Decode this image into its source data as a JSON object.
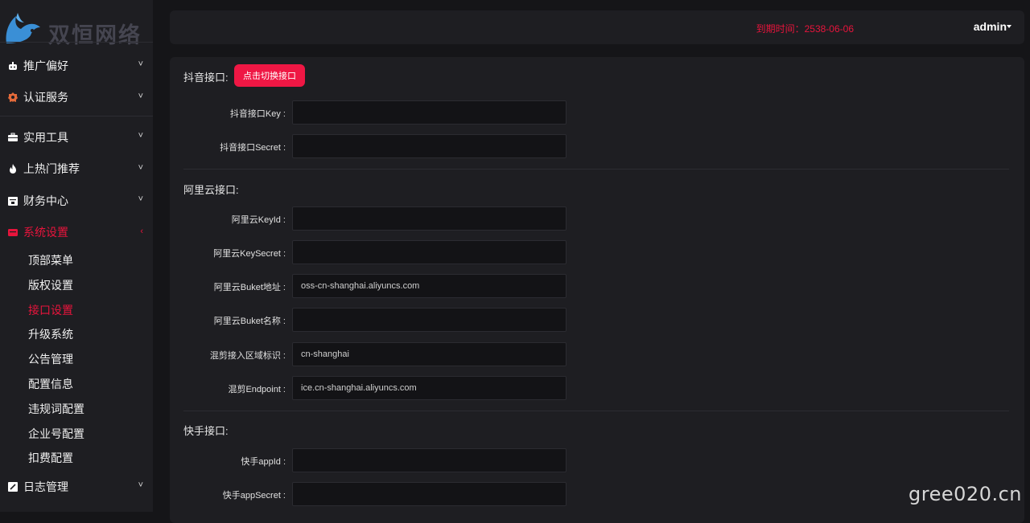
{
  "logo": {
    "text": "双恒网络"
  },
  "sidebar": {
    "top_items": [
      {
        "label": "推广偏好",
        "icon": "robot-icon",
        "chev": "˅"
      },
      {
        "label": "认证服务",
        "icon": "badge-icon",
        "chev": "˅"
      }
    ],
    "mid_items": [
      {
        "label": "实用工具",
        "icon": "toolbox-icon",
        "chev": "˅"
      },
      {
        "label": "上热门推荐",
        "icon": "fire-icon",
        "chev": "˅"
      },
      {
        "label": "财务中心",
        "icon": "wallet-icon",
        "chev": "˅"
      },
      {
        "label": "系统设置",
        "icon": "settings-icon",
        "chev": "‹"
      }
    ],
    "sub_items": [
      "顶部菜单",
      "版权设置",
      "接口设置",
      "升级系统",
      "公告管理",
      "配置信息",
      "违规词配置",
      "企业号配置",
      "扣费配置"
    ],
    "bottom_item": {
      "label": "日志管理",
      "icon": "log-icon",
      "chev": "˅"
    },
    "accent_color": "#e8143c"
  },
  "header": {
    "expire_text": "到期时间：2538-06-06",
    "user": "admin"
  },
  "douyin": {
    "title": "抖音接口:",
    "switch_button": "点击切换接口",
    "fields": [
      {
        "label": "抖音接口Key :",
        "value": ""
      },
      {
        "label": "抖音接口Secret :",
        "value": ""
      }
    ]
  },
  "aliyun": {
    "title": "阿里云接口:",
    "fields": [
      {
        "label": "阿里云KeyId :",
        "value": ""
      },
      {
        "label": "阿里云KeySecret :",
        "value": ""
      },
      {
        "label": "阿里云Buket地址 :",
        "value": "oss-cn-shanghai.aliyuncs.com"
      },
      {
        "label": "阿里云Buket名称 :",
        "value": ""
      },
      {
        "label": "混剪接入区域标识 :",
        "value": "cn-shanghai"
      },
      {
        "label": "混剪Endpoint :",
        "value": "ice.cn-shanghai.aliyuncs.com"
      }
    ]
  },
  "kuaishou": {
    "title": "快手接口:",
    "fields": [
      {
        "label": "快手appId :",
        "value": ""
      },
      {
        "label": "快手appSecret :",
        "value": ""
      }
    ]
  },
  "watermark": "gree020.cn"
}
